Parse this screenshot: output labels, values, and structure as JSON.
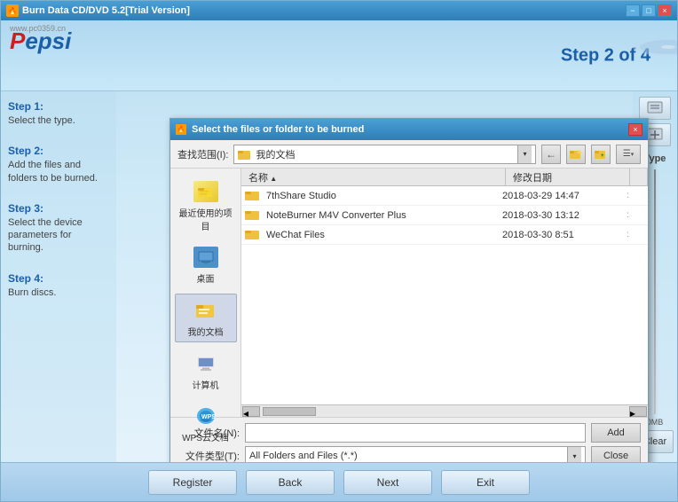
{
  "window": {
    "title": "Burn Data CD/DVD 5.2[Trial Version]",
    "close": "×",
    "minimize": "−",
    "maximize": "□"
  },
  "header": {
    "logo": "Peps",
    "step_indicator": "Step 2 of 4",
    "website": "www.pc0359.cn"
  },
  "steps": [
    {
      "label": "Step 1:",
      "desc": "Select the type."
    },
    {
      "label": "Step 2:",
      "desc": "Add the files and folders to be burned."
    },
    {
      "label": "Step 3:",
      "desc": "Select the device parameters for burning."
    },
    {
      "label": "Step 4:",
      "desc": "Burn discs."
    }
  ],
  "dialog": {
    "title": "Select the files or folder to be burned",
    "close": "×",
    "toolbar": {
      "label": "查找范围(I):",
      "location": "我的文档",
      "back_btn": "←",
      "folder_btn": "📁",
      "new_folder_btn": "📂",
      "view_btn": "☰▾"
    },
    "nav_items": [
      {
        "label": "最近使用的项目",
        "icon": "recent"
      },
      {
        "label": "桌面",
        "icon": "desktop"
      },
      {
        "label": "我的文档",
        "icon": "mydocs"
      },
      {
        "label": "计算机",
        "icon": "computer"
      },
      {
        "label": "WPS云文档",
        "icon": "wps"
      }
    ],
    "filelist": {
      "columns": [
        "名称",
        "修改日期"
      ],
      "files": [
        {
          "name": "7thShare Studio",
          "date": "2018-03-29 14:47",
          "extra": ":"
        },
        {
          "name": "NoteBurner M4V Converter Plus",
          "date": "2018-03-30 13:12",
          "extra": ":"
        },
        {
          "name": "WeChat Files",
          "date": "2018-03-30 8:51",
          "extra": ":"
        }
      ]
    },
    "bottom": {
      "filename_label": "文件名(N):",
      "filename_value": "",
      "filetype_label": "文件类型(T):",
      "filetype_value": "All Folders and Files (*.*)",
      "add_btn": "Add",
      "close_btn": "Close"
    }
  },
  "right_sidebar": {
    "type_label": "Type",
    "size_label": "0MB",
    "clear_btn": "Clear"
  },
  "bottom_bar": {
    "register_btn": "Register",
    "back_btn": "Back",
    "next_btn": "Next",
    "exit_btn": "Exit"
  }
}
